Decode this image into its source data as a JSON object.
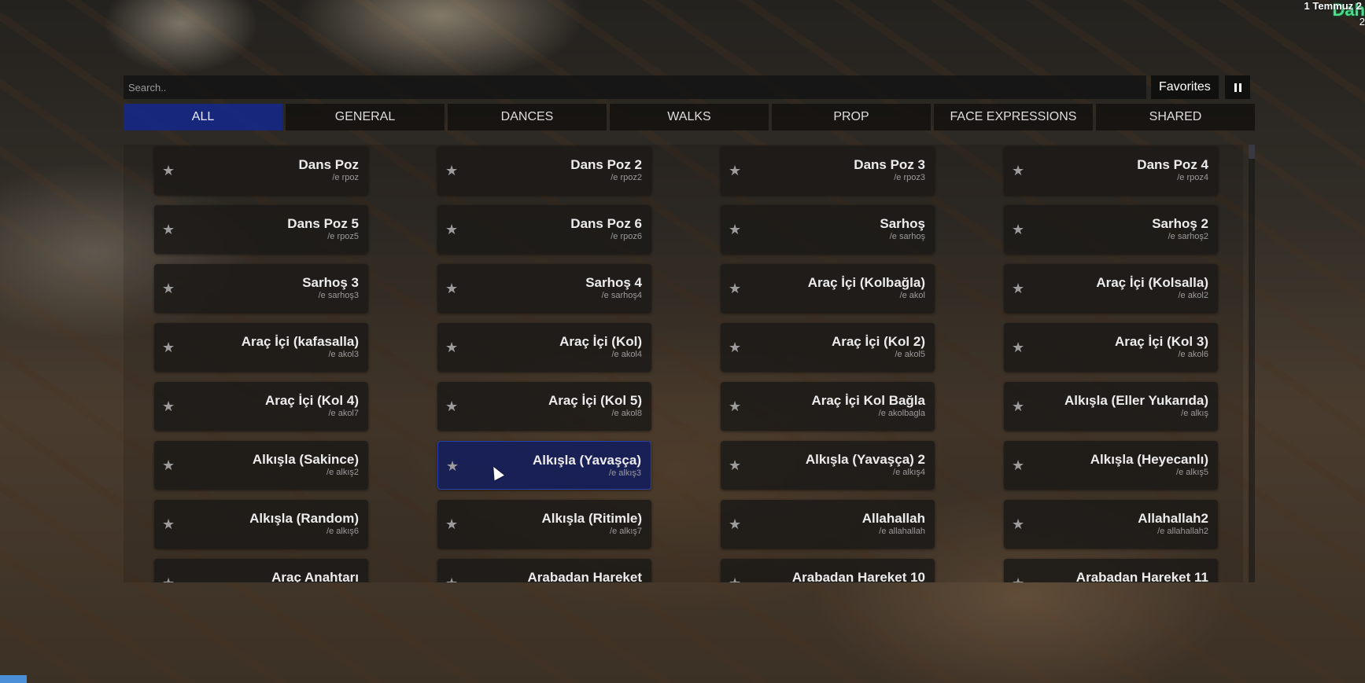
{
  "hud": {
    "clock_text": "1 Temmuz 2",
    "clock_sub": "2",
    "logo_text": "Dah"
  },
  "search": {
    "placeholder": "Search.."
  },
  "favorites_label": "Favorites",
  "pause_icon": "pause-icon",
  "tabs": [
    {
      "label": "ALL",
      "active": true
    },
    {
      "label": "GENERAL",
      "active": false
    },
    {
      "label": "DANCES",
      "active": false
    },
    {
      "label": "WALKS",
      "active": false
    },
    {
      "label": "PROP",
      "active": false
    },
    {
      "label": "FACE EXPRESSIONS",
      "active": false
    },
    {
      "label": "SHARED",
      "active": false
    }
  ],
  "colors": {
    "active_tab": "#14288c",
    "selected_card_border": "#2b3fa8",
    "logo_green": "#4ddc8a"
  },
  "emotes": [
    {
      "title": "Dans Poz",
      "cmd": "/e rpoz"
    },
    {
      "title": "Dans Poz 2",
      "cmd": "/e rpoz2"
    },
    {
      "title": "Dans Poz 3",
      "cmd": "/e rpoz3"
    },
    {
      "title": "Dans Poz 4",
      "cmd": "/e rpoz4"
    },
    {
      "title": "Dans Poz 5",
      "cmd": "/e rpoz5"
    },
    {
      "title": "Dans Poz 6",
      "cmd": "/e rpoz6"
    },
    {
      "title": "Sarhoş",
      "cmd": "/e sarhoş"
    },
    {
      "title": "Sarhoş 2",
      "cmd": "/e sarhoş2"
    },
    {
      "title": "Sarhoş 3",
      "cmd": "/e sarhoş3"
    },
    {
      "title": "Sarhoş 4",
      "cmd": "/e sarhoş4"
    },
    {
      "title": "Araç İçi (Kolbağla)",
      "cmd": "/e akol"
    },
    {
      "title": "Araç İçi (Kolsalla)",
      "cmd": "/e akol2"
    },
    {
      "title": "Araç İçi (kafasalla)",
      "cmd": "/e akol3"
    },
    {
      "title": "Araç İçi (Kol)",
      "cmd": "/e akol4"
    },
    {
      "title": "Araç İçi (Kol 2)",
      "cmd": "/e akol5"
    },
    {
      "title": "Araç İçi (Kol 3)",
      "cmd": "/e akol6"
    },
    {
      "title": "Araç İçi (Kol 4)",
      "cmd": "/e akol7"
    },
    {
      "title": "Araç İçi (Kol 5)",
      "cmd": "/e akol8"
    },
    {
      "title": "Araç İçi Kol Bağla",
      "cmd": "/e akolbagla"
    },
    {
      "title": "Alkışla (Eller Yukarıda)",
      "cmd": "/e alkış"
    },
    {
      "title": "Alkışla (Sakince)",
      "cmd": "/e alkış2"
    },
    {
      "title": "Alkışla (Yavaşça)",
      "cmd": "/e alkış3",
      "selected": true
    },
    {
      "title": "Alkışla (Yavaşça) 2",
      "cmd": "/e alkış4"
    },
    {
      "title": "Alkışla (Heyecanlı)",
      "cmd": "/e alkış5"
    },
    {
      "title": "Alkışla (Random)",
      "cmd": "/e alkış6"
    },
    {
      "title": "Alkışla (Ritimle)",
      "cmd": "/e alkış7"
    },
    {
      "title": "Allahallah",
      "cmd": "/e allahallah"
    },
    {
      "title": "Allahallah2",
      "cmd": "/e allahallah2"
    },
    {
      "title": "Araç Anahtarı",
      "cmd": ""
    },
    {
      "title": "Arabadan Hareket",
      "cmd": ""
    },
    {
      "title": "Arabadan Hareket 10",
      "cmd": ""
    },
    {
      "title": "Arabadan Hareket 11",
      "cmd": ""
    }
  ]
}
